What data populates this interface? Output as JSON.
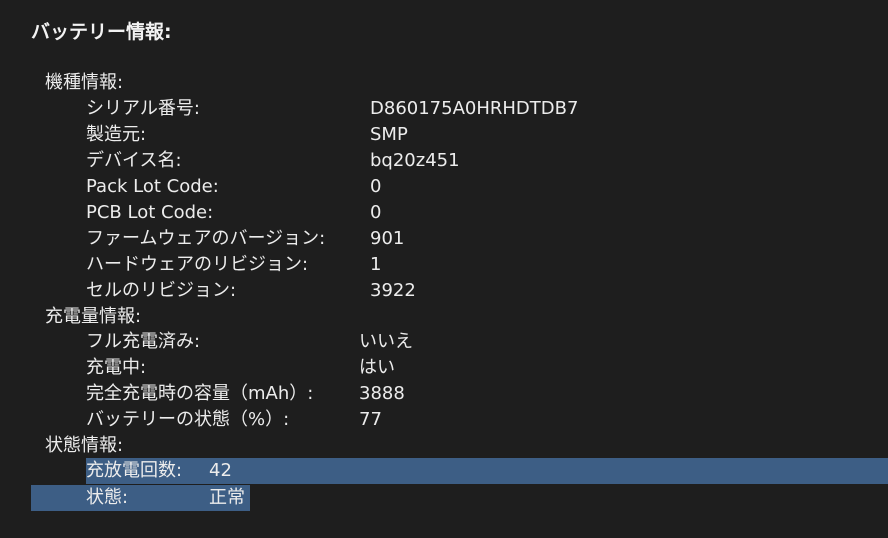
{
  "title": "バッテリー情報:",
  "sections": {
    "model": {
      "header": "機種情報:",
      "rows": [
        {
          "label": "シリアル番号:",
          "value": "D860175A0HRHDTDB7"
        },
        {
          "label": "製造元:",
          "value": "SMP"
        },
        {
          "label": "デバイス名:",
          "value": "bq20z451"
        },
        {
          "label": "Pack Lot Code:",
          "value": "0"
        },
        {
          "label": "PCB Lot Code:",
          "value": "0"
        },
        {
          "label": "ファームウェアのバージョン:",
          "value": "901"
        },
        {
          "label": "ハードウェアのリビジョン:",
          "value": "1"
        },
        {
          "label": "セルのリビジョン:",
          "value": "3922"
        }
      ]
    },
    "charge": {
      "header": "充電量情報:",
      "rows": [
        {
          "label": "フル充電済み:",
          "value": "いいえ"
        },
        {
          "label": "充電中:",
          "value": "はい"
        },
        {
          "label": "完全充電時の容量（mAh）:",
          "value": "3888"
        },
        {
          "label": "バッテリーの状態（%）:",
          "value": "77"
        }
      ]
    },
    "health": {
      "header": "状態情報:",
      "rows": [
        {
          "label": "充放電回数:",
          "value": "42"
        },
        {
          "label": "状態:",
          "value": "正常"
        }
      ]
    }
  },
  "colors": {
    "background": "#1e1e1e",
    "text": "#ececec",
    "selection": "#3d5e85"
  }
}
